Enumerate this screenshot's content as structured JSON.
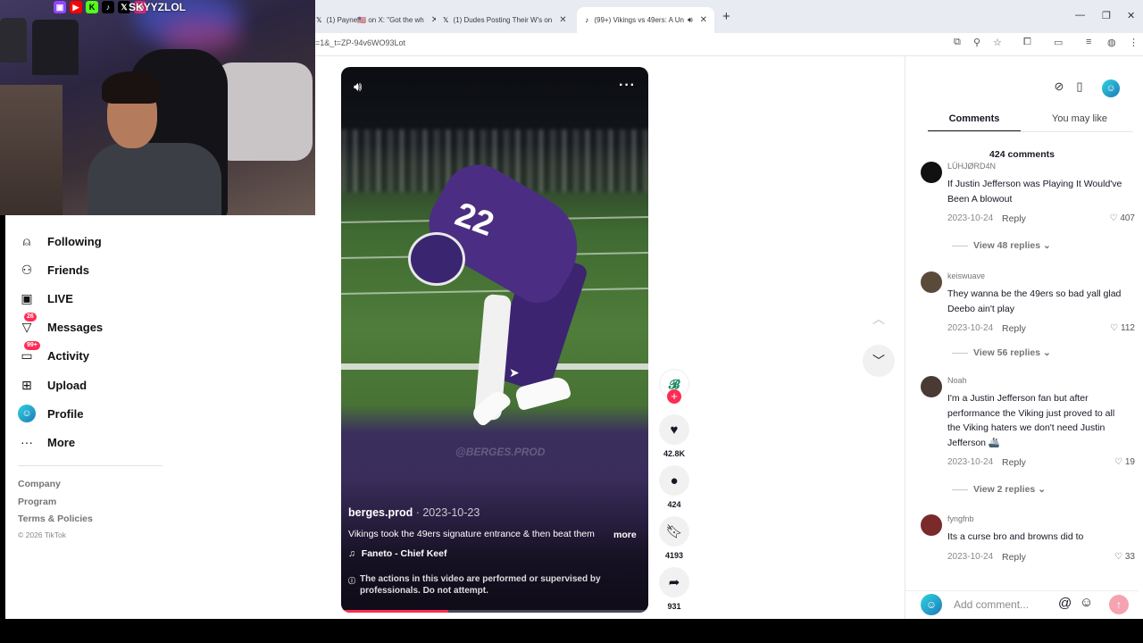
{
  "overlay": {
    "handle": "SKYYZLOL",
    "socials": [
      "twitch-icon",
      "youtube-icon",
      "kick-icon",
      "tiktok-icon",
      "x-icon",
      "instagram-icon"
    ],
    "kick_label": "K",
    "x_label": "𝕏"
  },
  "browser": {
    "tabs": [
      {
        "title": "(1) Payne🇺🇸 on X: \"Got the wh",
        "icon": "x-icon",
        "fav": "𝕏"
      },
      {
        "title": "(1) Dudes Posting Their W's on",
        "icon": "x-icon",
        "fav": "𝕏"
      },
      {
        "title": "(99+) Vikings vs 49ers: A Un",
        "icon": "tiktok-icon",
        "fav": "♪"
      }
    ],
    "url": "=1&_t=ZP-94v6WO93Lot"
  },
  "sidebar": {
    "items": [
      {
        "label": "Following",
        "icon": "following-icon"
      },
      {
        "label": "Friends",
        "icon": "friends-icon"
      },
      {
        "label": "LIVE",
        "icon": "live-icon"
      },
      {
        "label": "Messages",
        "icon": "messages-icon",
        "badge": "26"
      },
      {
        "label": "Activity",
        "icon": "activity-icon",
        "badge": "99+"
      },
      {
        "label": "Upload",
        "icon": "upload-icon"
      },
      {
        "label": "Profile",
        "icon": "profile-icon"
      },
      {
        "label": "More",
        "icon": "more-icon"
      }
    ],
    "footer": {
      "links": [
        "Company",
        "Program",
        "Terms & Policies"
      ],
      "copyright": "© 2026 TikTok"
    }
  },
  "video": {
    "author": "berges.prod",
    "date_separator": " · ",
    "date": "2023-10-23",
    "caption": "Vikings took the 49ers signature entrance & then beat them",
    "caption_more": "more",
    "music": "Faneto - Chief Keef",
    "warning": "The actions in this video are performed or supervised by professionals. Do not attempt.",
    "watermark": "@BERGES.PROD",
    "jersey_number": "22",
    "progress": 0.35,
    "progress_color": "#fe2c55"
  },
  "actions": {
    "likes": "42.8K",
    "comments": "424",
    "saves": "4193",
    "shares": "931"
  },
  "panel": {
    "tabs": [
      "Comments",
      "You may like"
    ],
    "comment_count": "424 comments",
    "comments": [
      {
        "user": "LÜHJØRD4N",
        "text": "If Justin Jefferson was Playing It Would've Been A blowout",
        "date": "2023-10-24",
        "reply": "Reply",
        "likes": "407",
        "view_replies": "View 48 replies",
        "avatar_color": "#111111"
      },
      {
        "user": "keiswuave",
        "text": "They wanna be the 49ers so bad yall glad Deebo ain't play",
        "date": "2023-10-24",
        "reply": "Reply",
        "likes": "112",
        "view_replies": "View 56 replies",
        "avatar_color": "#5a4a3a"
      },
      {
        "user": "Noah",
        "text": "I'm a Justin Jefferson fan but after performance the Viking just proved to all the Viking haters we don't need Justin Jefferson 🚢",
        "date": "2023-10-24",
        "reply": "Reply",
        "likes": "19",
        "view_replies": "View 2 replies",
        "avatar_color": "#4a3a33"
      },
      {
        "user": "fyngfnb",
        "text": "Its a curse bro and browns did to",
        "date": "2023-10-24",
        "reply": "Reply",
        "likes": "33",
        "view_replies": "",
        "avatar_color": "#7a2a2a"
      }
    ],
    "input_placeholder": "Add comment...",
    "accent": "#fe2c55"
  }
}
